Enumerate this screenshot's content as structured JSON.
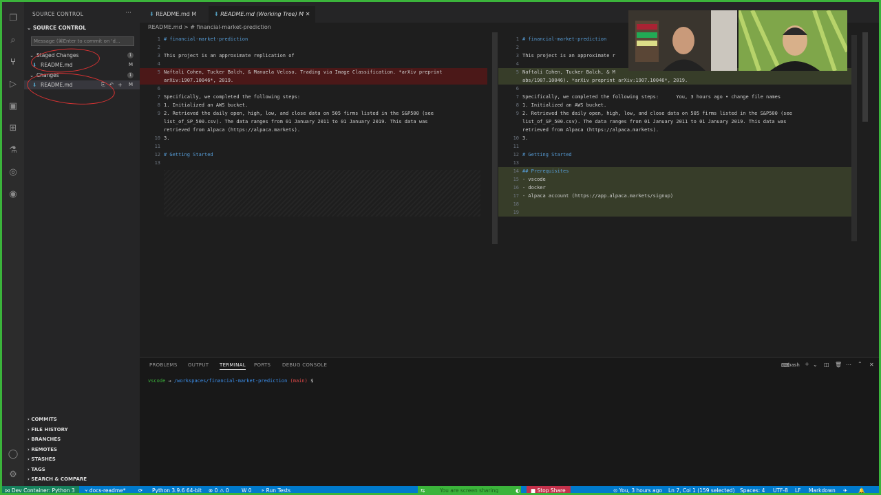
{
  "sidebar": {
    "title": "SOURCE CONTROL",
    "more": "···",
    "section": "SOURCE CONTROL",
    "commit_placeholder": "Message (⌘Enter to commit on 'd...",
    "staged_label": "Staged Changes",
    "staged_count": "1",
    "staged_file": "README.md",
    "staged_status": "M",
    "changes_label": "Changes",
    "changes_count": "1",
    "changes_file": "README.md",
    "changes_status": "M",
    "bottom_sections": [
      "COMMITS",
      "FILE HISTORY",
      "BRANCHES",
      "REMOTES",
      "STASHES",
      "TAGS",
      "SEARCH & COMPARE"
    ]
  },
  "tabs": [
    {
      "label": "README.md  M"
    },
    {
      "label": "README.md (Working Tree)  M"
    }
  ],
  "breadcrumb": "README.md > # financial-market-prediction",
  "left_pane": [
    {
      "n": "1",
      "t": "# financial-market-prediction",
      "c": "hdr"
    },
    {
      "n": "2",
      "t": ""
    },
    {
      "n": "3",
      "t": "This project is an approximate replication of"
    },
    {
      "n": "4",
      "t": ""
    },
    {
      "n": "5",
      "t": "Naftali Cohen, Tucker Balch, & Manuela Veloso. Trading via Image Classification. *arXiv preprint",
      "c": "del"
    },
    {
      "n": "",
      "t": "arXiv:1907.10046*, 2019.",
      "c": "del"
    },
    {
      "n": "6",
      "t": ""
    },
    {
      "n": "7",
      "t": "Specifically, we completed the following steps:"
    },
    {
      "n": "8",
      "t": "1. Initialized an AWS bucket."
    },
    {
      "n": "9",
      "t": "2. Retrieved the daily open, high, low, and close data on 505 firms listed in the S&P500 (see"
    },
    {
      "n": "",
      "t": "list_of_SP_500.csv). The data ranges from 01 January 2011 to 01 January 2019. This data was"
    },
    {
      "n": "",
      "t": "retrieved from Alpaca (https://alpaca.markets)."
    },
    {
      "n": "10",
      "t": "3."
    },
    {
      "n": "11",
      "t": ""
    },
    {
      "n": "12",
      "t": "# Getting Started",
      "c": "hdr"
    },
    {
      "n": "13",
      "t": ""
    }
  ],
  "right_pane": [
    {
      "n": "1",
      "t": "# financial-market-prediction",
      "c": "hdr"
    },
    {
      "n": "2",
      "t": ""
    },
    {
      "n": "3",
      "t": "This project is an approximate r"
    },
    {
      "n": "4",
      "t": ""
    },
    {
      "n": "5",
      "t": "Naftali Cohen, Tucker Balch, & M",
      "c": "add"
    },
    {
      "n": "",
      "t": "abs/1907.10046). *arXiv preprint arXiv:1907.10046*, 2019.",
      "c": "add"
    },
    {
      "n": "6",
      "t": ""
    },
    {
      "n": "7",
      "t": "Specifically, we completed the following steps:      You, 3 hours ago • change file names"
    },
    {
      "n": "8",
      "t": "1. Initialized an AWS bucket."
    },
    {
      "n": "9",
      "t": "2. Retrieved the daily open, high, low, and close data on 505 firms listed in the S&P500 (see"
    },
    {
      "n": "",
      "t": "list_of_SP_500.csv). The data ranges from 01 January 2011 to 01 January 2019. This data was"
    },
    {
      "n": "",
      "t": "retrieved from Alpaca (https://alpaca.markets)."
    },
    {
      "n": "10",
      "t": "3."
    },
    {
      "n": "11",
      "t": ""
    },
    {
      "n": "12",
      "t": "# Getting Started",
      "c": "hdr"
    },
    {
      "n": "13",
      "t": ""
    },
    {
      "n": "14",
      "t": "## Prerequisites",
      "c": "add hdr"
    },
    {
      "n": "15",
      "t": "- vscode",
      "c": "add"
    },
    {
      "n": "16",
      "t": "- docker",
      "c": "add"
    },
    {
      "n": "17",
      "t": "- Alpaca account (https://app.alpaca.markets/signup)",
      "c": "add"
    },
    {
      "n": "18",
      "t": "",
      "c": "add"
    },
    {
      "n": "19",
      "t": "",
      "c": "add"
    }
  ],
  "panel": {
    "tabs": [
      "PROBLEMS",
      "OUTPUT",
      "TERMINAL",
      "PORTS",
      "DEBUG CONSOLE"
    ],
    "active_tab": "TERMINAL",
    "shell": "bash",
    "prompt_user": "vscode",
    "prompt_path": "/workspaces/financial-market-prediction",
    "prompt_branch": "(main)",
    "prompt_end": "$"
  },
  "status": {
    "remote": "Dev Container: Python 3",
    "branch": "docs-readme*",
    "python": "Python 3.9.6 64-bit",
    "problems": "⊗ 0  ⚠ 0",
    "warn": "W 0",
    "run_tests": "Run Tests",
    "sharing": "You are screen sharing",
    "stop_share": "Stop Share",
    "blame": "You, 3 hours ago",
    "position": "Ln 7, Col 1 (159 selected)",
    "spaces": "Spaces: 4",
    "encoding": "UTF-8",
    "eol": "LF",
    "language": "Markdown"
  },
  "colors": {
    "accent": "#007acc",
    "share_border": "#3bb43b",
    "deleted": "#4b1818",
    "added": "#373d29",
    "stop": "#c4314b"
  }
}
